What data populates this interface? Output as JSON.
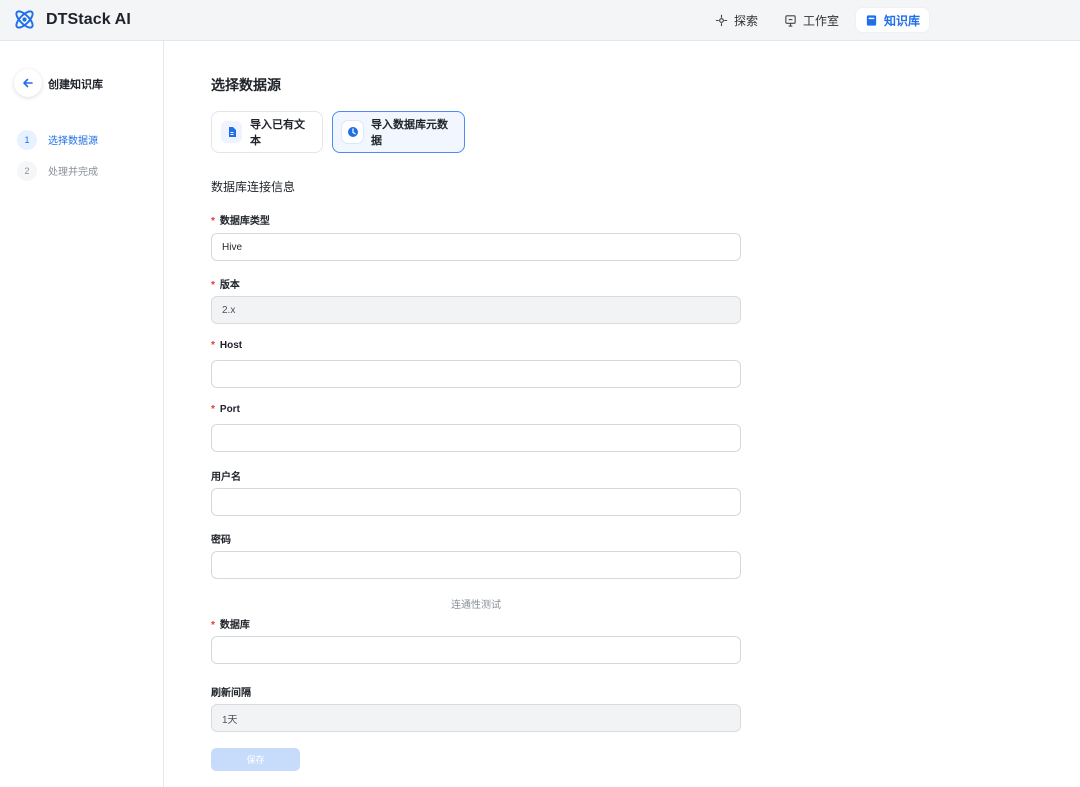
{
  "app": {
    "name": "DTStack AI"
  },
  "colors": {
    "accent": "#1f6fe8",
    "required": "#e53935",
    "header_bg": "#f3f5f7"
  },
  "nav": {
    "items": [
      {
        "label": "探索",
        "icon": "explore-icon"
      },
      {
        "label": "工作室",
        "icon": "studio-icon"
      },
      {
        "label": "知识库",
        "icon": "book-icon",
        "active": true
      }
    ]
  },
  "sidebar": {
    "title": "创建知识库",
    "steps": [
      {
        "num": "1",
        "label": "选择数据源",
        "active": true
      },
      {
        "num": "2",
        "label": "处理并完成",
        "active": false
      }
    ]
  },
  "main": {
    "section_title": "选择数据源",
    "sources": [
      {
        "label": "导入已有文本",
        "icon": "document-icon"
      },
      {
        "label": "导入数据库元数据",
        "icon": "database-icon",
        "selected": true
      }
    ],
    "connection_title": "数据库连接信息",
    "fields": {
      "db_type": {
        "label": "数据库类型",
        "value": "Hive",
        "required": true
      },
      "version": {
        "label": "版本",
        "value": "2.x",
        "required": true,
        "disabled": true
      },
      "host": {
        "label": "Host",
        "value": "",
        "required": true
      },
      "port": {
        "label": "Port",
        "value": "",
        "required": true
      },
      "username": {
        "label": "用户名",
        "value": ""
      },
      "password": {
        "label": "密码",
        "value": ""
      },
      "database": {
        "label": "数据库",
        "value": "",
        "required": true
      },
      "refresh": {
        "label": "刷新间隔",
        "value": "1天",
        "disabled": true
      }
    },
    "test_link": "连通性测试",
    "save_label": "保存"
  }
}
